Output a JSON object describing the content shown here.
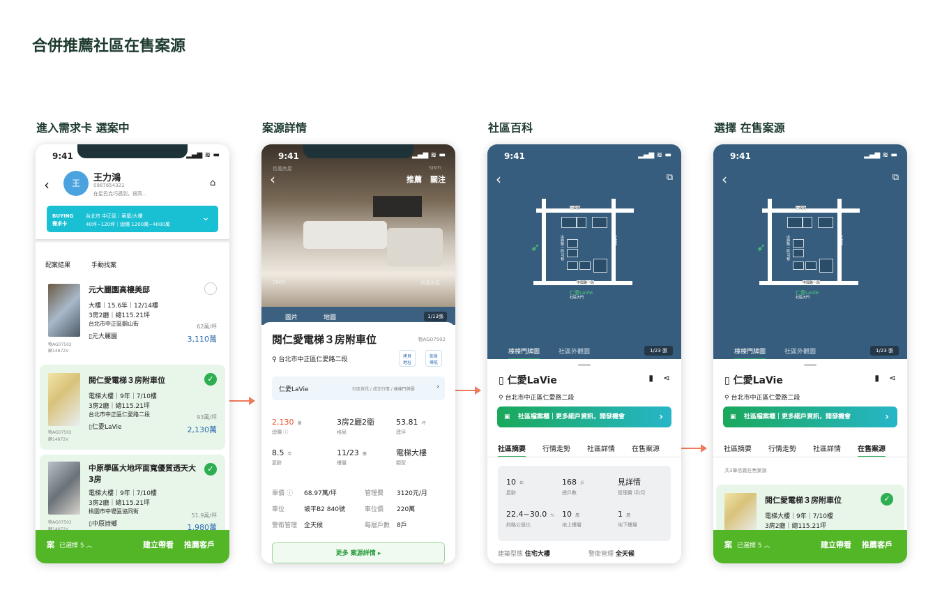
{
  "page_title": "合併推薦社區在售案源",
  "sections": [
    "進入需求卡  選案中",
    "案源詳情",
    "社區百科",
    "選擇 在售案源"
  ],
  "status": {
    "time": "9:41",
    "icons": "▂▄▆ ≋ ▬"
  },
  "p1": {
    "name": "王力鴻",
    "avatar": "王",
    "phone": "0987654321",
    "note": "在星巴克巧遇到，很高...",
    "buying": "BUYING",
    "need_card": "需求卡",
    "need_line1": "台北市 中正區｜華廈/大樓",
    "need_line2": "40坪~120坪｜總價 1200萬~4000萬",
    "tab_match": "配案結果",
    "tab_manual": "手動找案",
    "listings": [
      {
        "title": "元大麗園高樓美邸",
        "l1": "大樓｜15.6年｜12/14樓",
        "l2": "3房2廳｜總115.21坪",
        "l3": "台北市中正區鋼山街",
        "comm": "元大麗園",
        "unit": "62萬/坪",
        "price": "3,110萬",
        "id1": "物AG07502",
        "id2": "顧14872V"
      },
      {
        "title": "閱仁愛電梯３房附車位",
        "l1": "電梯大樓｜9年｜7/10樓",
        "l2": "3房2廳｜總115.21坪",
        "l3": "台北市中正區仁愛路二段",
        "comm": "仁愛LaVie",
        "unit": "93萬/坪",
        "price": "2,130萬",
        "id1": "物AG07502",
        "id2": "顧14872V"
      },
      {
        "title": "中原學區大地坪面寬優質透天大3房",
        "l1": "電梯大樓｜9年｜7/10樓",
        "l2": "3房2廳｜總115.21坪",
        "l3": "桃園市中壢區協同街",
        "comm": "中原詩鄉",
        "unit": "51.9萬/坪",
        "price": "1,980萬",
        "id1": "物AG07502",
        "id2": "顧14872V"
      }
    ],
    "bar": {
      "case": "案",
      "selected": "已選擇 5 ︿",
      "btn1": "建立帶看",
      "btn2": "推薦客戶"
    }
  },
  "p2": {
    "top_btn1": "推薦",
    "top_btn2": "關注",
    "wm1": "信義房屋",
    "wm2": "SINYI",
    "tab_photo": "圖片",
    "tab_map": "地圖",
    "count": "1/13張",
    "title": "閱仁愛電梯３房附車位",
    "id": "物AG07502",
    "address": "台北市中正區仁愛路二段",
    "btn_copy": "拷貝\n地址",
    "btn_nav": "街景\n導航",
    "comm": "仁愛LaVie",
    "comm_links": "社區資訊 / 成交行情 / 棟棟門牌圖",
    "stats": [
      {
        "v": "2,130",
        "u": "萬",
        "l": "總價 ⓘ"
      },
      {
        "v": "3房2廳2衛",
        "u": "",
        "l": "格局"
      },
      {
        "v": "53.81",
        "u": "坪",
        "l": "建坪"
      },
      {
        "v": "8.5",
        "u": "年",
        "l": "屋齡"
      },
      {
        "v": "11/23",
        "u": "樓",
        "l": "樓層"
      },
      {
        "v": "電梯大樓",
        "u": "",
        "l": "類型"
      }
    ],
    "rows": [
      [
        "單價 ⓘ",
        "68.97萬/坪",
        "管理費",
        "3120元/月"
      ],
      [
        "車位",
        "坡平B2 840號",
        "車位價",
        "220萬"
      ],
      [
        "警衛管理",
        "全天候",
        "每層戶數",
        "8戶"
      ]
    ],
    "more": "更多 案源詳情 ▸"
  },
  "p3": {
    "map": {
      "road_top": "行政街",
      "road_left": "中興路一段37巷",
      "road_right": "行政巷",
      "road_bottom": "中興路一段",
      "name": "仁愛LaVie",
      "sub": "社區大門"
    },
    "tab_a": "棟棟門牌圖",
    "tab_b": "社區外觀圖",
    "count": "1/23 張",
    "name": "仁愛LaVie",
    "address": "台北市中正區仁愛路二段",
    "banner": "社區檔案櫃｜更多細戶資訊，開發機會",
    "tabs": [
      "社區摘要",
      "行情走勢",
      "社區詳情",
      "在售案源"
    ],
    "stats": [
      {
        "v": "10",
        "u": "年",
        "l": "屋齡"
      },
      {
        "v": "168",
        "u": "戶",
        "l": "總戶數"
      },
      {
        "v": "見詳情",
        "u": "",
        "l": "管理費 坪/月"
      },
      {
        "v": "22.4~30.0",
        "u": "%",
        "l": "約略公設比"
      },
      {
        "v": "10",
        "u": "層",
        "l": "地上樓層"
      },
      {
        "v": "1",
        "u": "層",
        "l": "地下樓層"
      }
    ],
    "row": [
      "建築型態",
      "住宅大樓",
      "警衛管理",
      "全天候"
    ]
  },
  "p4": {
    "note": "共3筆信義在售案源",
    "listing": {
      "title": "閱仁愛電梯３房附車位",
      "l1": "電梯大樓｜9年｜7/10樓",
      "l2": "3房2廳｜總115.21坪"
    }
  }
}
